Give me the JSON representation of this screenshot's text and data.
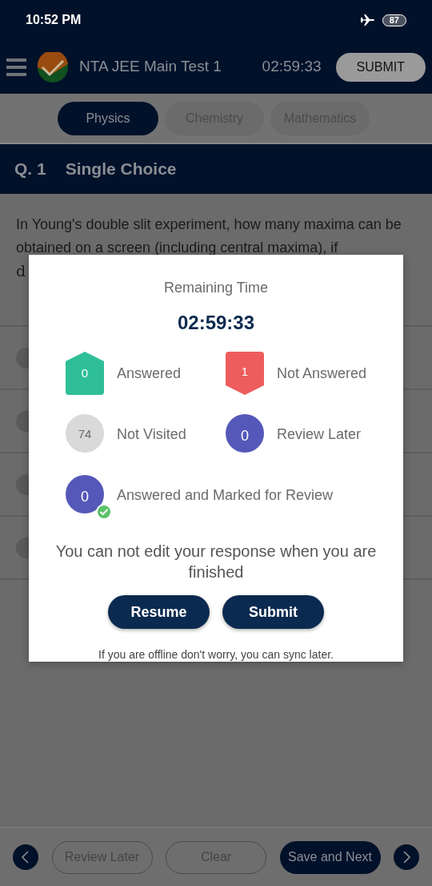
{
  "status_bar": {
    "time": "10:52 PM",
    "battery": "87"
  },
  "header": {
    "title": "NTA JEE Main Test 1",
    "timer": "02:59:33",
    "submit": "SUBMIT"
  },
  "tabs": [
    {
      "label": "Physics",
      "selected": true
    },
    {
      "label": "Chemistry",
      "selected": false
    },
    {
      "label": "Mathematics",
      "selected": false
    }
  ],
  "question": {
    "number": "Q. 1",
    "type": "Single Choice",
    "text": "In Young's double slit experiment, how many maxima can be obtained on a screen (including central maxima), if",
    "text_cut": "d"
  },
  "dialog": {
    "title": "Remaining Time",
    "time": "02:59:33",
    "stats": [
      {
        "kind": "answered",
        "count": "0",
        "label": "Answered",
        "color": "#2fbf98"
      },
      {
        "kind": "not_answered",
        "count": "1",
        "label": "Not Answered",
        "color": "#ee5d5d"
      },
      {
        "kind": "not_visited",
        "count": "74",
        "label": "Not Visited",
        "color": "#d9d9d9"
      },
      {
        "kind": "review",
        "count": "0",
        "label": "Review Later",
        "color": "#5558b8"
      },
      {
        "kind": "answered_review",
        "count": "0",
        "label": "Answered and Marked for Review",
        "color": "#5558b8"
      }
    ],
    "warning": "You can not edit your response when you are finished",
    "buttons": [
      "Resume",
      "Submit"
    ],
    "note": "If you are offline don't worry, you can sync later."
  },
  "bottom_bar": {
    "buttons": [
      {
        "kind": "outline",
        "label": "Review Later"
      },
      {
        "kind": "outline",
        "label": "Clear"
      },
      {
        "kind": "filled",
        "label": "Save and Next"
      }
    ]
  }
}
